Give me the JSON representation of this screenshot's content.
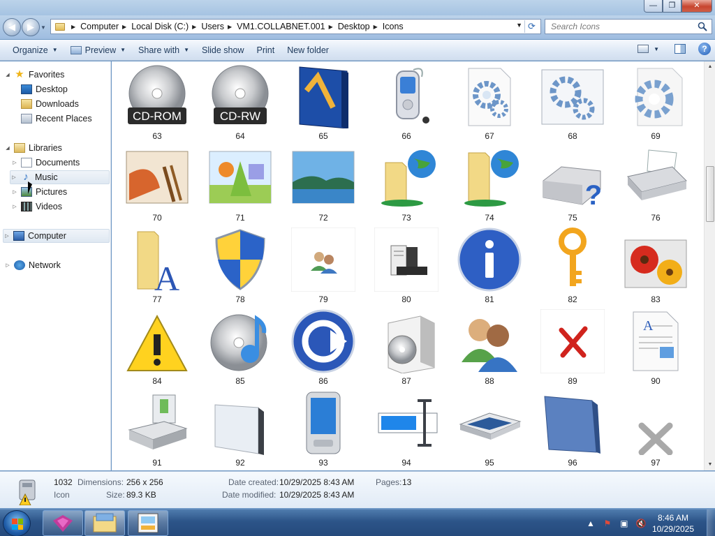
{
  "window": {
    "buttons": {
      "minimize": "—",
      "maximize": "❐",
      "close": "✕"
    }
  },
  "address": {
    "crumbs": [
      "Computer",
      "Local Disk (C:)",
      "Users",
      "VM1.COLLABNET.001",
      "Desktop",
      "Icons"
    ]
  },
  "search": {
    "placeholder": "Search Icons"
  },
  "toolbar": {
    "organize": "Organize",
    "preview": "Preview",
    "share_with": "Share with",
    "slide_show": "Slide show",
    "print": "Print",
    "new_folder": "New folder"
  },
  "sidebar": {
    "favorites": "Favorites",
    "desktop": "Desktop",
    "downloads": "Downloads",
    "recent_places": "Recent Places",
    "libraries": "Libraries",
    "documents": "Documents",
    "music": "Music",
    "pictures": "Pictures",
    "videos": "Videos",
    "computer": "Computer",
    "network": "Network"
  },
  "files": [
    {
      "label": "63",
      "icon": "cd-rom-icon"
    },
    {
      "label": "64",
      "icon": "cd-rw-icon"
    },
    {
      "label": "65",
      "icon": "visual-studio-icon"
    },
    {
      "label": "66",
      "icon": "mobile-phone-icon"
    },
    {
      "label": "67",
      "icon": "config-file-icon"
    },
    {
      "label": "68",
      "icon": "gears-window-icon"
    },
    {
      "label": "69",
      "icon": "gear-document-icon"
    },
    {
      "label": "70",
      "icon": "paint-icon"
    },
    {
      "label": "71",
      "icon": "shapes-picture-icon"
    },
    {
      "label": "72",
      "icon": "landscape-picture-icon"
    },
    {
      "label": "73",
      "icon": "network-folder-icon"
    },
    {
      "label": "74",
      "icon": "network-folder-open-icon"
    },
    {
      "label": "75",
      "icon": "unknown-drive-icon"
    },
    {
      "label": "76",
      "icon": "fax-icon"
    },
    {
      "label": "77",
      "icon": "fonts-folder-icon"
    },
    {
      "label": "78",
      "icon": "uac-shield-icon"
    },
    {
      "label": "79",
      "icon": "users-icon"
    },
    {
      "label": "80",
      "icon": "server-icon"
    },
    {
      "label": "81",
      "icon": "info-icon"
    },
    {
      "label": "82",
      "icon": "key-icon"
    },
    {
      "label": "83",
      "icon": "flowers-picture-icon"
    },
    {
      "label": "84",
      "icon": "warning-icon"
    },
    {
      "label": "85",
      "icon": "audio-cd-icon"
    },
    {
      "label": "86",
      "icon": "sync-arrow-icon"
    },
    {
      "label": "87",
      "icon": "software-box-icon"
    },
    {
      "label": "88",
      "icon": "user-accounts-icon"
    },
    {
      "label": "89",
      "icon": "red-x-icon"
    },
    {
      "label": "90",
      "icon": "document-icon"
    },
    {
      "label": "91",
      "icon": "card-reader-icon"
    },
    {
      "label": "92",
      "icon": "glass-panel-icon"
    },
    {
      "label": "93",
      "icon": "pda-icon"
    },
    {
      "label": "94",
      "icon": "text-field-icon"
    },
    {
      "label": "95",
      "icon": "scanner-icon"
    },
    {
      "label": "96",
      "icon": "blue-folder-icon"
    },
    {
      "label": "97",
      "icon": "gray-x-icon"
    }
  ],
  "details": {
    "name": "1032",
    "type": "Icon",
    "dimensions_key": "Dimensions:",
    "dimensions": "256 x 256",
    "size_key": "Size:",
    "size": "89.3 KB",
    "created_key": "Date created:",
    "created": "10/29/2025 8:43 AM",
    "modified_key": "Date modified:",
    "modified": "10/29/2025 8:43 AM",
    "pages_key": "Pages:",
    "pages": "13"
  },
  "taskbar": {
    "time": "8:46 AM",
    "date": "10/29/2025"
  }
}
